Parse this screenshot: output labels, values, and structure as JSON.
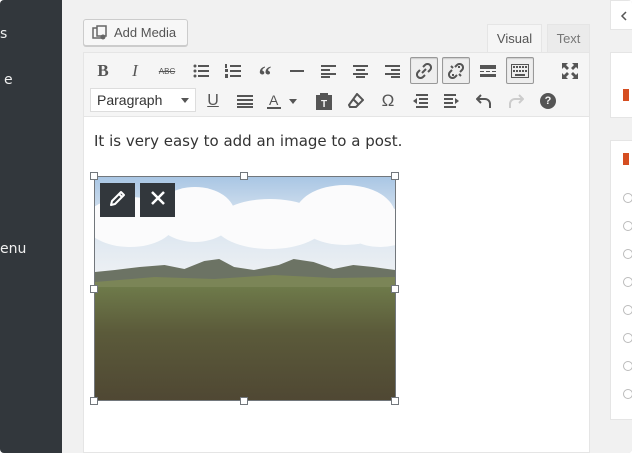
{
  "admin_menu": {
    "items": [
      {
        "label": "s"
      },
      {
        "label": "e"
      },
      {
        "label": "enu"
      }
    ]
  },
  "media": {
    "add_media_label": "Add Media"
  },
  "editor_tabs": {
    "visual": "Visual",
    "text": "Text"
  },
  "toolbar": {
    "format_value": "Paragraph",
    "buttons_row1": [
      "bold-icon",
      "italic-icon",
      "strikethrough-icon",
      "bullet-list-icon",
      "numbered-list-icon",
      "blockquote-icon",
      "horizontal-rule-icon",
      "align-left-icon",
      "align-center-icon",
      "align-right-icon",
      "insert-link-icon",
      "remove-link-icon",
      "read-more-icon",
      "toolbar-toggle-icon",
      "fullscreen-icon"
    ],
    "buttons_row2": [
      "underline-icon",
      "justify-icon",
      "text-color-icon",
      "paste-text-icon",
      "clear-formatting-icon",
      "special-character-icon",
      "outdent-icon",
      "indent-icon",
      "undo-icon",
      "redo-icon",
      "help-icon"
    ],
    "bold_glyph": "B",
    "italic_glyph": "I",
    "strike_glyph": "ABC",
    "quote_glyph": "“",
    "omega_glyph": "Ω",
    "help_glyph": "?"
  },
  "content": {
    "paragraph": "It is very easy to add an image to a post."
  },
  "colors": {
    "admin_bar": "#32373c",
    "toolbar_bg": "#f5f5f5",
    "image_toolbar": "#32373c"
  }
}
